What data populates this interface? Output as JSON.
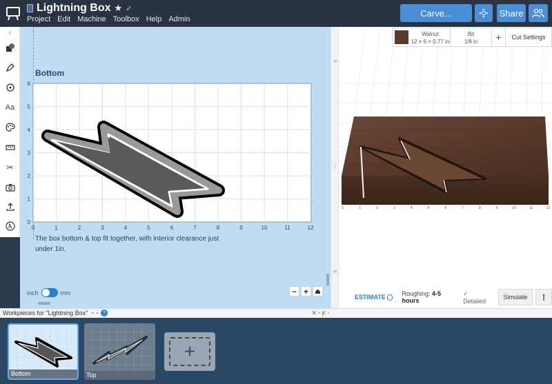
{
  "header": {
    "project_title": "Lightning Box",
    "menu": [
      "Project",
      "Edit",
      "Machine",
      "Toolbox",
      "Help",
      "Admin"
    ],
    "carve_label": "Carve...",
    "share_label": "Share"
  },
  "design": {
    "workpiece_title": "Bottom",
    "x_ticks": [
      "0",
      "1",
      "2",
      "3",
      "4",
      "5",
      "6",
      "7",
      "8",
      "9",
      "10",
      "11",
      "12"
    ],
    "y_ticks": [
      "0",
      "1",
      "2",
      "3",
      "4",
      "5",
      "6"
    ],
    "description": "The box bottom & top fit together, with interior clearance just under 1in.",
    "unit_inch": "inch",
    "unit_mm": "mm",
    "zoom_out": "−",
    "zoom_in": "+"
  },
  "preview": {
    "material_name": "Walnut",
    "material_dims": "12 × 6 × 0.77 in",
    "bit_label": "Bit",
    "bit_value": "1/8 in",
    "add_label": "+",
    "cut_settings_label": "Cut Settings",
    "axis_ticks": [
      "0",
      "1",
      "2",
      "3",
      "4",
      "5",
      "6",
      "7",
      "8",
      "9",
      "10",
      "11",
      "12"
    ],
    "estimate_label": "ESTIMATE",
    "roughing_label": "Roughing:",
    "roughing_value": "4-5 hours",
    "detailed_label": "Detailed",
    "simulate_label": "Simulate",
    "more_label": "⋮"
  },
  "workpieces": {
    "header": "Workpieces for \"Lightning Box\"",
    "help": "?",
    "xy_readout": "x: - y: -",
    "items": [
      {
        "label": "Bottom"
      },
      {
        "label": "Top"
      }
    ]
  },
  "colors": {
    "accent": "#4a8fd6",
    "topbar": "#2a3342",
    "design_bg": "#bfdcf3",
    "wood": "#5a3a2a"
  }
}
